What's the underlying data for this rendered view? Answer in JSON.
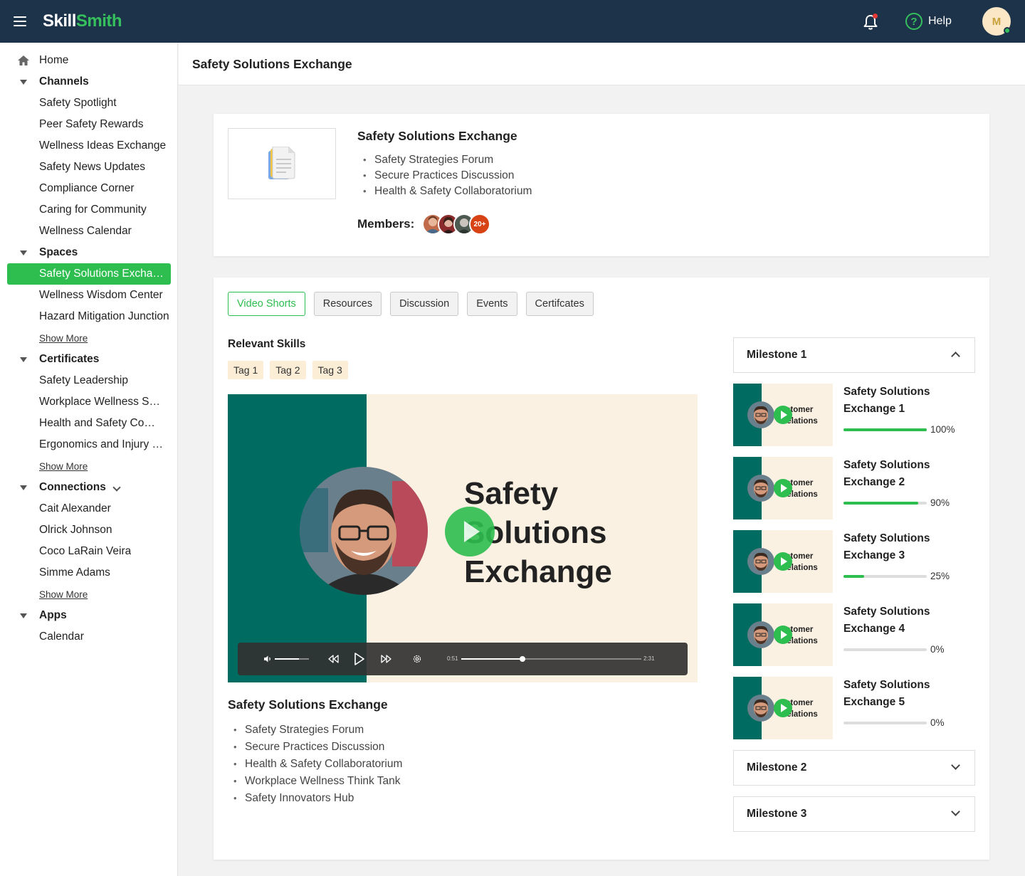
{
  "app": {
    "logo_a": "Skill",
    "logo_b": "Smith",
    "help_label": "Help",
    "avatar_initial": "M"
  },
  "colors": {
    "topbar": "#1d3349",
    "accent": "#2ebd4f",
    "video_green": "#006b61",
    "video_cream": "#faf1e2",
    "tag_bg": "#fbedd6"
  },
  "sidebar": {
    "home": "Home",
    "channels": {
      "label": "Channels",
      "items": [
        "Safety Spotlight",
        "Peer Safety Rewards",
        "Wellness Ideas Exchange",
        "Safety News Updates",
        "Compliance Corner",
        "Caring for Community",
        "Wellness Calendar"
      ]
    },
    "spaces": {
      "label": "Spaces",
      "items": [
        "Safety Solutions Exchange",
        "Wellness Wisdom Center",
        "Hazard Mitigation Junction"
      ],
      "show_more": "Show More"
    },
    "certificates": {
      "label": "Certificates",
      "items": [
        "Safety Leadership",
        "Workplace Wellness Specialist",
        "Health and Safety Compliance",
        "Ergonomics and Injury Prevention"
      ],
      "show_more": "Show More"
    },
    "connections": {
      "label": "Connections",
      "items": [
        "Cait Alexander",
        "Olrick Johnson",
        "Coco LaRain Veira",
        "Simme Adams"
      ],
      "show_more": "Show More"
    },
    "apps": {
      "label": "Apps",
      "items": [
        "Calendar"
      ]
    }
  },
  "page": {
    "title": "Safety Solutions Exchange"
  },
  "info": {
    "title": "Safety Solutions Exchange",
    "bullets": [
      "Safety Strategies Forum",
      "Secure Practices Discussion",
      "Health & Safety Collaboratorium"
    ],
    "members_label": "Members:",
    "members_more": "20+"
  },
  "tabs": [
    "Video Shorts",
    "Resources",
    "Discussion",
    "Events",
    "Certifcates"
  ],
  "skills": {
    "title": "Relevant Skills",
    "tags": [
      "Tag 1",
      "Tag 2",
      "Tag 3"
    ]
  },
  "video": {
    "title_lines": [
      "Safety",
      "Solutions",
      "Exchange"
    ],
    "time_current": "0:51",
    "time_total": "2:31",
    "progress": 0.34,
    "volume": 0.7
  },
  "description": {
    "title": "Safety Solutions Exchange",
    "bullets": [
      "Safety Strategies Forum",
      "Secure Practices Discussion",
      "Health & Safety Collaboratorium",
      "Workplace Wellness Think Tank",
      "Safety Innovators Hub"
    ]
  },
  "milestones": {
    "m1": "Milestone 1",
    "m2": "Milestone 2",
    "m3": "Milestone 3",
    "thumb_text": [
      "ustomer",
      "Relations"
    ],
    "items": [
      {
        "line1": "Safety Solutions",
        "line2": "Exchange 1",
        "progress": 100,
        "pct": "100%"
      },
      {
        "line1": "Safety Solutions",
        "line2": "Exchange 2",
        "progress": 90,
        "pct": "90%"
      },
      {
        "line1": "Safety Solutions",
        "line2": "Exchange 3",
        "progress": 25,
        "pct": "25%"
      },
      {
        "line1": "Safety Solutions",
        "line2": "Exchange 4",
        "progress": 0,
        "pct": "0%"
      },
      {
        "line1": "Safety Solutions",
        "line2": "Exchange 5",
        "progress": 0,
        "pct": "0%"
      }
    ]
  }
}
